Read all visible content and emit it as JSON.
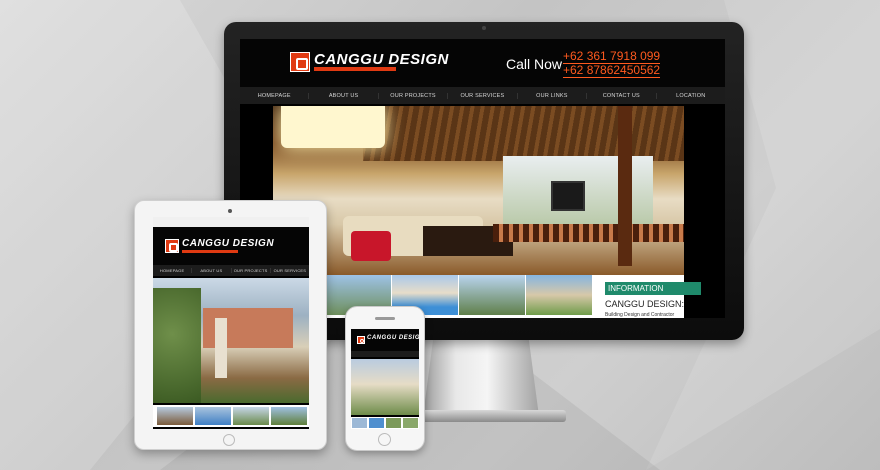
{
  "brand": {
    "name": "CANGGU DESIGN",
    "accent": "#e03a12",
    "info_color": "#1f8a6b"
  },
  "desktop": {
    "call_label": "Call Now",
    "phones": [
      "+62 361 7918 099",
      "+62 87862450562"
    ],
    "nav": [
      "HOMEPAGE",
      "ABOUT US",
      "OUR PROJECTS",
      "OUR SERVICES",
      "OUR LINKS",
      "CONTACT US",
      "LOCATION"
    ],
    "info": {
      "title": "INFORMATION",
      "heading": "CANGGU DESIGN:",
      "text": "Building Design and Contractor"
    }
  },
  "tablet": {
    "nav": [
      "HOMEPAGE",
      "ABOUT US",
      "OUR PROJECTS",
      "OUR SERVICES"
    ]
  }
}
